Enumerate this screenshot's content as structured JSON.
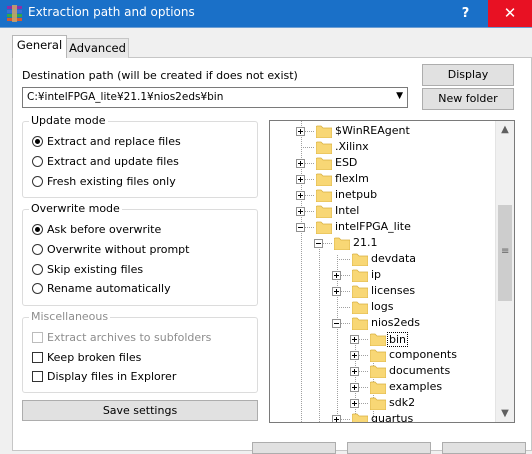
{
  "window": {
    "title": "Extraction path and options",
    "help_label": "?",
    "close_label": "✕"
  },
  "tabs": [
    {
      "label": "General",
      "active": true
    },
    {
      "label": "Advanced",
      "active": false
    }
  ],
  "destination": {
    "label": "Destination path (will be created if does not exist)",
    "value": "C:¥intelFPGA_lite¥21.1¥nios2eds¥bin"
  },
  "buttons": {
    "display": "Display",
    "new_folder": "New folder",
    "save_settings": "Save settings"
  },
  "update_mode": {
    "title": "Update mode",
    "options": [
      {
        "label": "Extract and replace files",
        "checked": true
      },
      {
        "label": "Extract and update files",
        "checked": false
      },
      {
        "label": "Fresh existing files only",
        "checked": false
      }
    ]
  },
  "overwrite_mode": {
    "title": "Overwrite mode",
    "options": [
      {
        "label": "Ask before overwrite",
        "checked": true
      },
      {
        "label": "Overwrite without prompt",
        "checked": false
      },
      {
        "label": "Skip existing files",
        "checked": false
      },
      {
        "label": "Rename automatically",
        "checked": false
      }
    ]
  },
  "miscellaneous": {
    "title": "Miscellaneous",
    "options": [
      {
        "label": "Extract archives to subfolders",
        "checked": false,
        "disabled": true
      },
      {
        "label": "Keep broken files",
        "checked": false,
        "disabled": false
      },
      {
        "label": "Display files in Explorer",
        "checked": false,
        "disabled": false
      }
    ]
  },
  "tree": {
    "nodes": [
      {
        "label": "$WinREAgent",
        "expander": "plus"
      },
      {
        "label": ".Xilinx",
        "expander": "none"
      },
      {
        "label": "ESD",
        "expander": "plus"
      },
      {
        "label": "flexlm",
        "expander": "plus"
      },
      {
        "label": "inetpub",
        "expander": "plus"
      },
      {
        "label": "Intel",
        "expander": "plus"
      },
      {
        "label": "intelFPGA_lite",
        "expander": "minus"
      },
      {
        "label": "21.1",
        "expander": "minus"
      },
      {
        "label": "devdata",
        "expander": "none"
      },
      {
        "label": "ip",
        "expander": "plus"
      },
      {
        "label": "licenses",
        "expander": "plus"
      },
      {
        "label": "logs",
        "expander": "none"
      },
      {
        "label": "nios2eds",
        "expander": "minus"
      },
      {
        "label": "bin",
        "expander": "plus",
        "selected": true
      },
      {
        "label": "components",
        "expander": "plus"
      },
      {
        "label": "documents",
        "expander": "plus"
      },
      {
        "label": "examples",
        "expander": "plus"
      },
      {
        "label": "sdk2",
        "expander": "plus"
      },
      {
        "label": "quartus",
        "expander": "plus"
      }
    ],
    "scroll_position": 0.55
  },
  "colors": {
    "titlebar": "#1a70c8",
    "close_button": "#e81123",
    "folder": "#f8d775"
  }
}
